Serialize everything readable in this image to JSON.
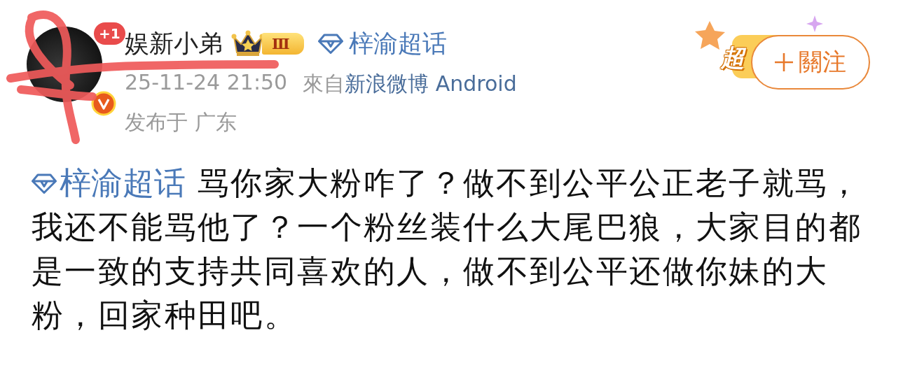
{
  "post": {
    "author": {
      "name": "娱新小弟",
      "notification_badge": "+1",
      "verified": true,
      "level_badge": "Ⅲ"
    },
    "topic": "梓渝超话",
    "time": "25-11-24 21:50",
    "source_prefix": "來自",
    "source": "新浪微博 Android",
    "location": "发布于 广东",
    "sticker_text": "超",
    "follow_button": "關注",
    "content_topic": "梓渝超话",
    "content": "骂你家大粉咋了？做不到公平公正老子就骂，我还不能骂他了？一个粉丝装什么大尾巴狼，大家目的都是一致的支持共同喜欢的人，做不到公平还做你妹的大粉，回家种田吧。"
  }
}
